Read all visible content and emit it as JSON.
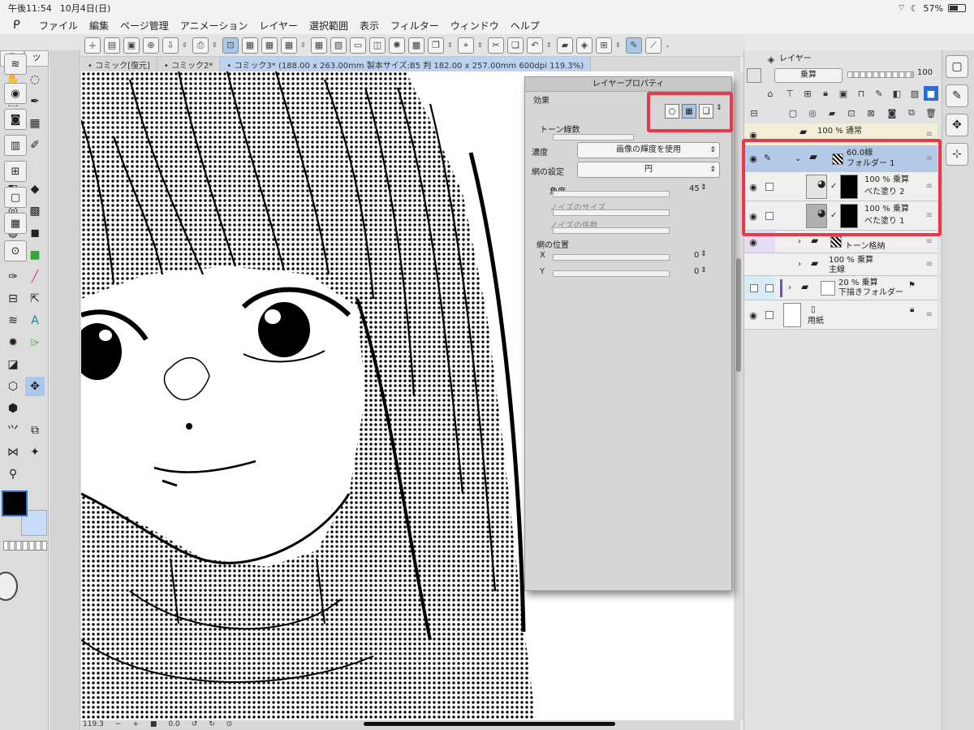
{
  "status": {
    "time": "午後11:54",
    "date": "10月4日(日)",
    "battery": "57%",
    "battery_level": 0.57
  },
  "menu": [
    "ファイル",
    "編集",
    "ページ管理",
    "アニメーション",
    "レイヤー",
    "選択範囲",
    "表示",
    "フィルター",
    "ウィンドウ",
    "ヘルプ"
  ],
  "tool_tabs": {
    "pen_tab": "ツ"
  },
  "doc_tabs": [
    "• コミック[復元]",
    "• コミック2*",
    "• コミック3* (188.00 x 263.00mm 製本サイズ:B5 判 182.00 x 257.00mm 600dpi 119.3%)"
  ],
  "bottom": {
    "zoom": "119.3",
    "angle": "0.0"
  },
  "layer_property": {
    "title": "レイヤープロパティ",
    "effect_label": "効果",
    "tone_lines_label": "トーン線数",
    "density_label": "濃度",
    "density_value": "画像の輝度を使用",
    "screen_setting_label": "網の設定",
    "screen_setting_value": "円",
    "angle_label": "角度",
    "angle_value": "45",
    "angle_level": 0.0,
    "noise_size_label": "ノイズのサイズ",
    "noise_factor_label": "ノイズの係数",
    "position_label": "網の位置",
    "x_label": "X",
    "x_value": "0",
    "y_label": "Y",
    "y_value": "0"
  },
  "layer_panel": {
    "tab_label": "レイヤー",
    "blend_mode": "乗算",
    "opacity": "100"
  },
  "layers": [
    {
      "top": "100 % 通常",
      "bottom": "",
      "selected": false
    },
    {
      "top": "60.0線",
      "bottom": "フォルダー 1",
      "selected": true
    },
    {
      "top": "100 %  乗算",
      "bottom": "べた塗り 2",
      "selected": false
    },
    {
      "top": "100 %  乗算",
      "bottom": "べた塗り 1",
      "selected": false
    },
    {
      "top": "",
      "bottom": "トーン格納",
      "selected": false
    },
    {
      "top": "100 %  乗算",
      "bottom": "主線",
      "selected": false
    },
    {
      "top": "20 %  乗算",
      "bottom": "下描きフォルダー",
      "selected": false
    },
    {
      "top": "",
      "bottom": "用紙",
      "selected": false
    }
  ],
  "colors": {
    "accent": "#a9c7e8",
    "highlight_box": "#e8384a",
    "selected_layer": "#b4c9e6"
  }
}
